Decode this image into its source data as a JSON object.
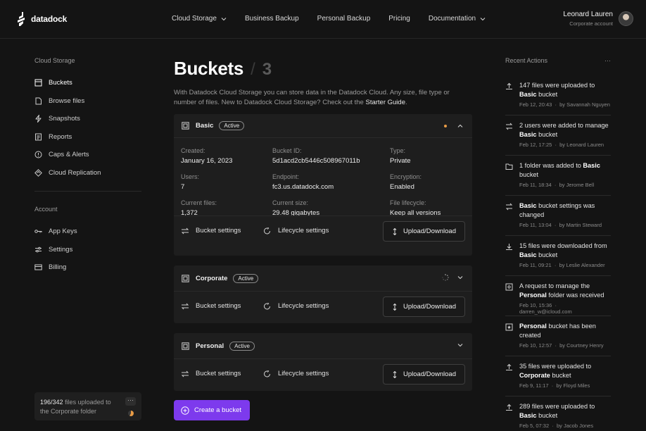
{
  "brand": {
    "name": "datadock"
  },
  "nav": [
    {
      "label": "Cloud Storage",
      "has_dropdown": true
    },
    {
      "label": "Business Backup",
      "has_dropdown": false
    },
    {
      "label": "Personal Backup",
      "has_dropdown": false
    },
    {
      "label": "Pricing",
      "has_dropdown": false
    },
    {
      "label": "Documentation",
      "has_dropdown": true
    }
  ],
  "user": {
    "name": "Leonard Lauren",
    "role": "Corporate account"
  },
  "sidebar": {
    "section1_title": "Cloud Storage",
    "section1_items": [
      {
        "label": "Buckets",
        "icon": "bucket-icon",
        "active": true
      },
      {
        "label": "Browse files",
        "icon": "file-icon"
      },
      {
        "label": "Snapshots",
        "icon": "bolt-icon"
      },
      {
        "label": "Reports",
        "icon": "report-icon"
      },
      {
        "label": "Caps & Alerts",
        "icon": "alert-icon"
      },
      {
        "label": "Cloud Replication",
        "icon": "replication-icon"
      }
    ],
    "section2_title": "Account",
    "section2_items": [
      {
        "label": "App Keys",
        "icon": "key-icon"
      },
      {
        "label": "Settings",
        "icon": "settings-icon"
      },
      {
        "label": "Billing",
        "icon": "billing-icon"
      }
    ]
  },
  "upload_status": {
    "count": "196/342",
    "text": "files uploaded to the Corporate folder",
    "progress_fraction": 0.573,
    "more": "···"
  },
  "page": {
    "title": "Buckets",
    "count": "3",
    "intro": "With Datadock Cloud Storage you can store data in the Datadock Cloud. Any size, file type or number of files. New to Datadock Cloud Storage? Check out the",
    "intro_link": "Starter Guide",
    "intro_end": "."
  },
  "buckets": [
    {
      "name": "Basic",
      "status": "Active",
      "expanded": true,
      "details": {
        "created_label": "Created:",
        "created": "January 16, 2023",
        "bucket_id_label": "Bucket ID:",
        "bucket_id": "5d1acd2cb5446c508967011b",
        "type_label": "Type:",
        "type": "Private",
        "users_label": "Users:",
        "users": "7",
        "endpoint_label": "Endpoint:",
        "endpoint": "fc3.us.datadock.com",
        "encryption_label": "Encryption:",
        "encryption": "Enabled",
        "files_label": "Current files:",
        "files": "1,372",
        "size_label": "Current size:",
        "size": "29.48 gigabytes",
        "lifecycle_label": "File lifecycle:",
        "lifecycle": "Keep all versions"
      }
    },
    {
      "name": "Corporate",
      "status": "Active",
      "expanded": false
    },
    {
      "name": "Personal",
      "status": "Active",
      "expanded": false
    }
  ],
  "bucket_actions": {
    "settings": "Bucket settings",
    "lifecycle": "Lifecycle settings",
    "upload": "Upload/Download"
  },
  "create_button": "Create a bucket",
  "recent": {
    "title": "Recent Actions",
    "more": "···",
    "items": [
      {
        "icon": "upload-icon",
        "pre": "147 files were uploaded to",
        "bold": "Basic",
        "post": "bucket",
        "date": "Feb 12, 20:43",
        "by": "by Savannah Nguyen"
      },
      {
        "icon": "users-icon",
        "pre": "2 users were added to manage",
        "bold": "Basic",
        "post": "bucket",
        "date": "Feb 12, 17:25",
        "by": "by Leonard Lauren"
      },
      {
        "icon": "folder-icon",
        "pre": "1 folder was added to",
        "bold": "Basic",
        "post": "bucket",
        "date": "Feb 11, 18:34",
        "by": "by Jerome Bell"
      },
      {
        "icon": "settings-icon",
        "pre": "",
        "bold": "Basic",
        "post": "bucket settings was changed",
        "date": "Feb 11, 13:04",
        "by": "by Martin Steward"
      },
      {
        "icon": "download-icon",
        "pre": "15 files were downloaded from",
        "bold": "Basic",
        "post": "bucket",
        "date": "Feb 11, 09:21",
        "by": "by Leslie Alexander"
      },
      {
        "icon": "request-icon",
        "pre": "A request to manage the",
        "bold": "Personal",
        "post": "folder was received",
        "date": "Feb 10, 15:36",
        "by": "darren_w@icloud.com"
      },
      {
        "icon": "created-icon",
        "pre": "",
        "bold": "Personal",
        "post": "bucket has been created",
        "date": "Feb 10, 12:57",
        "by": "by Courtney Henry"
      },
      {
        "icon": "upload-icon",
        "pre": "35 files were uploaded to",
        "bold": "Corporate",
        "post": "bucket",
        "date": "Feb 9, 11:17",
        "by": "by Floyd Miles"
      },
      {
        "icon": "upload-icon",
        "pre": "289 files were uploaded to",
        "bold": "Basic",
        "post": "bucket",
        "date": "Feb 5, 07:32",
        "by": "by Jacob Jones"
      }
    ]
  },
  "colors": {
    "accent": "#7d3aed",
    "status_dot": "#e89b45",
    "background": "#141414",
    "card": "#1e1e1e"
  }
}
